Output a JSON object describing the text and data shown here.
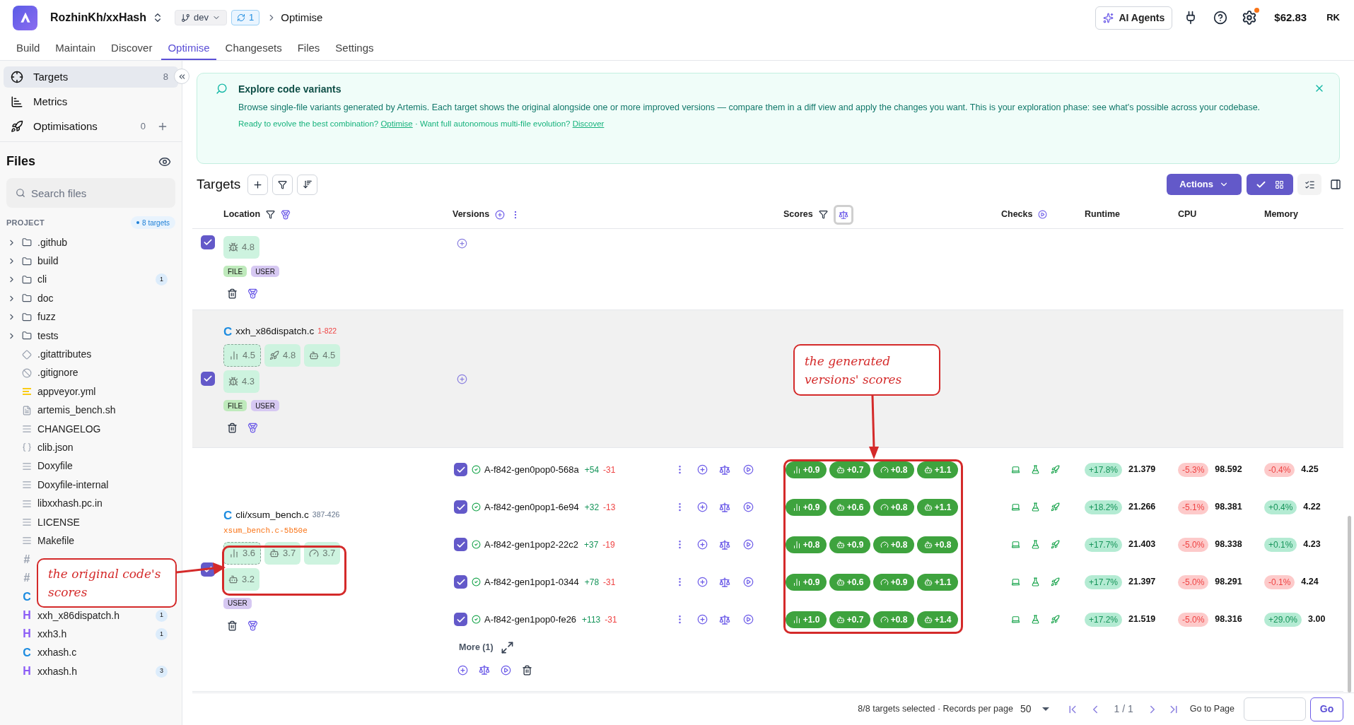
{
  "app": {
    "repo": "RozhinKh/xxHash",
    "branch": "dev",
    "sync_count": "1",
    "breadcrumb": "Optimise",
    "ai_button": "AI Agents",
    "balance": "$62.83",
    "user_initials": "RK",
    "settings_alert": true
  },
  "tabs": [
    {
      "label": "Build",
      "selected": false
    },
    {
      "label": "Maintain",
      "selected": false
    },
    {
      "label": "Discover",
      "selected": false
    },
    {
      "label": "Optimise",
      "selected": true
    },
    {
      "label": "Changesets",
      "selected": false
    },
    {
      "label": "Files",
      "selected": false
    },
    {
      "label": "Settings",
      "selected": false
    }
  ],
  "sidebar": {
    "nav": [
      {
        "label": "Targets",
        "count": "8",
        "selected": true
      },
      {
        "label": "Metrics",
        "selected": false
      },
      {
        "label": "Optimisations",
        "count": "0",
        "addable": true,
        "selected": false
      }
    ],
    "files_title": "Files",
    "search_placeholder": "Search files",
    "project_label": "PROJECT",
    "project_badge": "8 targets",
    "tree": [
      {
        "name": ".github",
        "kind": "folder",
        "expanded": false
      },
      {
        "name": "build",
        "kind": "folder",
        "expanded": false
      },
      {
        "name": "cli",
        "kind": "folder",
        "expanded": false,
        "badge": "1"
      },
      {
        "name": "doc",
        "kind": "folder",
        "expanded": false
      },
      {
        "name": "fuzz",
        "kind": "folder",
        "expanded": false
      },
      {
        "name": "tests",
        "kind": "folder",
        "expanded": false
      },
      {
        "name": ".gitattributes",
        "kind": "git"
      },
      {
        "name": ".gitignore",
        "kind": "ignore"
      },
      {
        "name": "appveyor.yml",
        "kind": "yaml"
      },
      {
        "name": "artemis_bench.sh",
        "kind": "script"
      },
      {
        "name": "CHANGELOG",
        "kind": "text"
      },
      {
        "name": "clib.json",
        "kind": "json"
      },
      {
        "name": "Doxyfile",
        "kind": "text"
      },
      {
        "name": "Doxyfile-internal",
        "kind": "text"
      },
      {
        "name": "libxxhash.pc.in",
        "kind": "text"
      },
      {
        "name": "LICENSE",
        "kind": "text"
      },
      {
        "name": "Makefile",
        "kind": "text"
      },
      {
        "glyph": "#",
        "kind": "md"
      },
      {
        "glyph": "#",
        "kind": "md"
      },
      {
        "glyph": "C",
        "kind": "c"
      },
      {
        "name": "xxh_x86dispatch.h",
        "glyph": "H",
        "kind": "h",
        "badge": "1"
      },
      {
        "name": "xxh3.h",
        "glyph": "H",
        "kind": "h",
        "badge": "1"
      },
      {
        "name": "xxhash.c",
        "glyph": "C",
        "kind": "c"
      },
      {
        "name": "xxhash.h",
        "glyph": "H",
        "kind": "h",
        "badge": "3"
      }
    ]
  },
  "banner": {
    "title": "Explore code variants",
    "text": "Browse single-file variants generated by Artemis. Each target shows the original alongside one or more improved versions — compare them in a diff view and apply the changes you want. This is your exploration phase: see what's possible across your codebase.",
    "footer": [
      {
        "prompt": "Ready to evolve the best combination?",
        "link": "Optimise"
      },
      {
        "prompt": "· Want full autonomous multi-file evolution?",
        "link": "Discover"
      }
    ]
  },
  "targets": {
    "title": "Targets",
    "actions_button": "Actions"
  },
  "columns": [
    {
      "label": "Location"
    },
    {
      "label": "Versions"
    },
    {
      "label": "Scores",
      "compare_on": true
    },
    {
      "label": "Checks"
    },
    {
      "label": "Runtime"
    },
    {
      "label": "CPU"
    },
    {
      "label": "Memory"
    }
  ],
  "rows": [
    {
      "selected": true,
      "hovered": false,
      "scores": [
        {
          "kind": "bug",
          "value": "4.8"
        }
      ],
      "tags": [
        {
          "label": "FILE",
          "kind": "file"
        },
        {
          "label": "USER",
          "kind": "user"
        }
      ]
    },
    {
      "selected": true,
      "hovered": true,
      "file": {
        "glyph": "C",
        "name": "xxh_x86dispatch.c",
        "range": "1-822",
        "range_alert": true
      },
      "scores": [
        {
          "kind": "chart",
          "value": "4.5"
        },
        {
          "kind": "rocket",
          "value": "4.8"
        },
        {
          "kind": "bot",
          "value": "4.5"
        },
        {
          "kind": "bug",
          "value": "4.3"
        }
      ],
      "tags": [
        {
          "label": "FILE",
          "kind": "file"
        },
        {
          "label": "USER",
          "kind": "user"
        }
      ]
    },
    {
      "selected": true,
      "hovered": false,
      "file": {
        "glyph": "C",
        "name": "cli/xsum_bench.c",
        "range": "387-426",
        "range_alert": false,
        "variant": "xsum_bench.c-5b50e"
      },
      "scores": [
        {
          "kind": "chart",
          "value": "3.6"
        },
        {
          "kind": "bot",
          "value": "3.7"
        },
        {
          "kind": "gauge",
          "value": "3.7"
        },
        {
          "kind": "bot",
          "value": "3.2"
        }
      ],
      "tags": [
        {
          "label": "USER",
          "kind": "user"
        }
      ],
      "versions": [
        {
          "name": "A-f842-gen0pop0-568a",
          "checked": true,
          "added": "+54",
          "removed": "-31",
          "scores": [
            {
              "kind": "chart",
              "value": "+0.9"
            },
            {
              "kind": "bot",
              "value": "+0.7"
            },
            {
              "kind": "gauge",
              "value": "+0.8"
            },
            {
              "kind": "bot",
              "value": "+1.1"
            }
          ],
          "runtime": {
            "delta": "+17.8%",
            "good": true,
            "value": "21.379"
          },
          "cpu": {
            "delta": "-5.3%",
            "good": false,
            "value": "98.592"
          },
          "memory": {
            "delta": "-0.4%",
            "good": false,
            "value": "4.25"
          }
        },
        {
          "name": "A-f842-gen0pop1-6e94",
          "checked": true,
          "added": "+32",
          "removed": "-13",
          "scores": [
            {
              "kind": "chart",
              "value": "+0.9"
            },
            {
              "kind": "bot",
              "value": "+0.6"
            },
            {
              "kind": "gauge",
              "value": "+0.8"
            },
            {
              "kind": "bot",
              "value": "+1.1"
            }
          ],
          "runtime": {
            "delta": "+18.2%",
            "good": true,
            "value": "21.266"
          },
          "cpu": {
            "delta": "-5.1%",
            "good": false,
            "value": "98.381"
          },
          "memory": {
            "delta": "+0.4%",
            "good": true,
            "value": "4.22"
          }
        },
        {
          "name": "A-f842-gen1pop2-22c2",
          "checked": true,
          "added": "+37",
          "removed": "-19",
          "scores": [
            {
              "kind": "chart",
              "value": "+0.8"
            },
            {
              "kind": "bot",
              "value": "+0.9"
            },
            {
              "kind": "gauge",
              "value": "+0.8"
            },
            {
              "kind": "bot",
              "value": "+0.8"
            }
          ],
          "runtime": {
            "delta": "+17.7%",
            "good": true,
            "value": "21.403"
          },
          "cpu": {
            "delta": "-5.0%",
            "good": false,
            "value": "98.338"
          },
          "memory": {
            "delta": "+0.1%",
            "good": true,
            "value": "4.23"
          }
        },
        {
          "name": "A-f842-gen1pop1-0344",
          "checked": true,
          "added": "+78",
          "removed": "-31",
          "scores": [
            {
              "kind": "chart",
              "value": "+0.9"
            },
            {
              "kind": "bot",
              "value": "+0.6"
            },
            {
              "kind": "gauge",
              "value": "+0.9"
            },
            {
              "kind": "bot",
              "value": "+1.1"
            }
          ],
          "runtime": {
            "delta": "+17.7%",
            "good": true,
            "value": "21.397"
          },
          "cpu": {
            "delta": "-5.0%",
            "good": false,
            "value": "98.291"
          },
          "memory": {
            "delta": "-0.1%",
            "good": false,
            "value": "4.24"
          }
        },
        {
          "name": "A-f842-gen1pop0-fe26",
          "checked": true,
          "added": "+113",
          "removed": "-31",
          "scores": [
            {
              "kind": "chart",
              "value": "+1.0"
            },
            {
              "kind": "bot",
              "value": "+0.7"
            },
            {
              "kind": "gauge",
              "value": "+0.8"
            },
            {
              "kind": "bot",
              "value": "+1.4"
            }
          ],
          "runtime": {
            "delta": "+17.2%",
            "good": true,
            "value": "21.519"
          },
          "cpu": {
            "delta": "-5.0%",
            "good": false,
            "value": "98.316"
          },
          "memory": {
            "delta": "+29.0%",
            "good": true,
            "value": "3.00"
          }
        }
      ],
      "more": "More (1)"
    }
  ],
  "footer": {
    "selection": "8/8 targets selected · Records per page",
    "per_page": "50",
    "page": "1 / 1",
    "goto_label": "Go to Page",
    "go": "Go"
  },
  "annotations": [
    {
      "text": "the original code's scores"
    },
    {
      "text": "the generated versions' scores"
    }
  ]
}
